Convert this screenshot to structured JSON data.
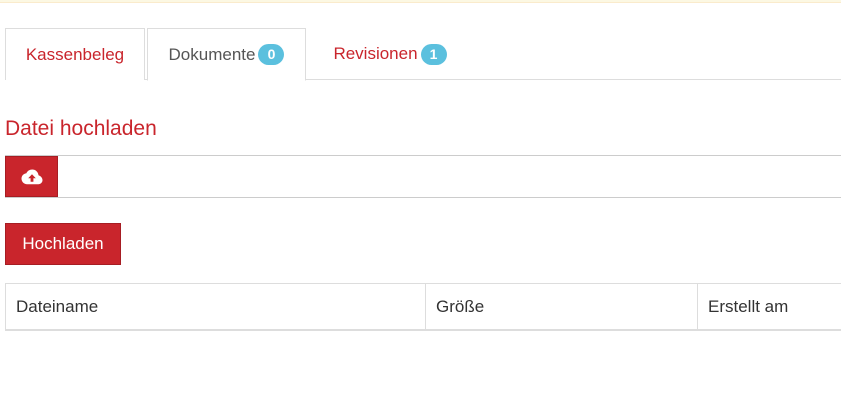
{
  "tabs": [
    {
      "label": "Kassenbeleg"
    },
    {
      "label": "Dokumente",
      "badge": "0"
    },
    {
      "label": "Revisionen",
      "badge": "1"
    }
  ],
  "upload": {
    "title": "Datei hochladen",
    "icon": "cloud-upload-icon",
    "button_label": "Hochladen"
  },
  "table": {
    "columns": [
      "Dateiname",
      "Größe",
      "Erstellt am"
    ],
    "rows": []
  },
  "colors": {
    "accent": "#c9252c",
    "badge": "#5bc0de",
    "alert_strip": "#fcf8e3"
  }
}
